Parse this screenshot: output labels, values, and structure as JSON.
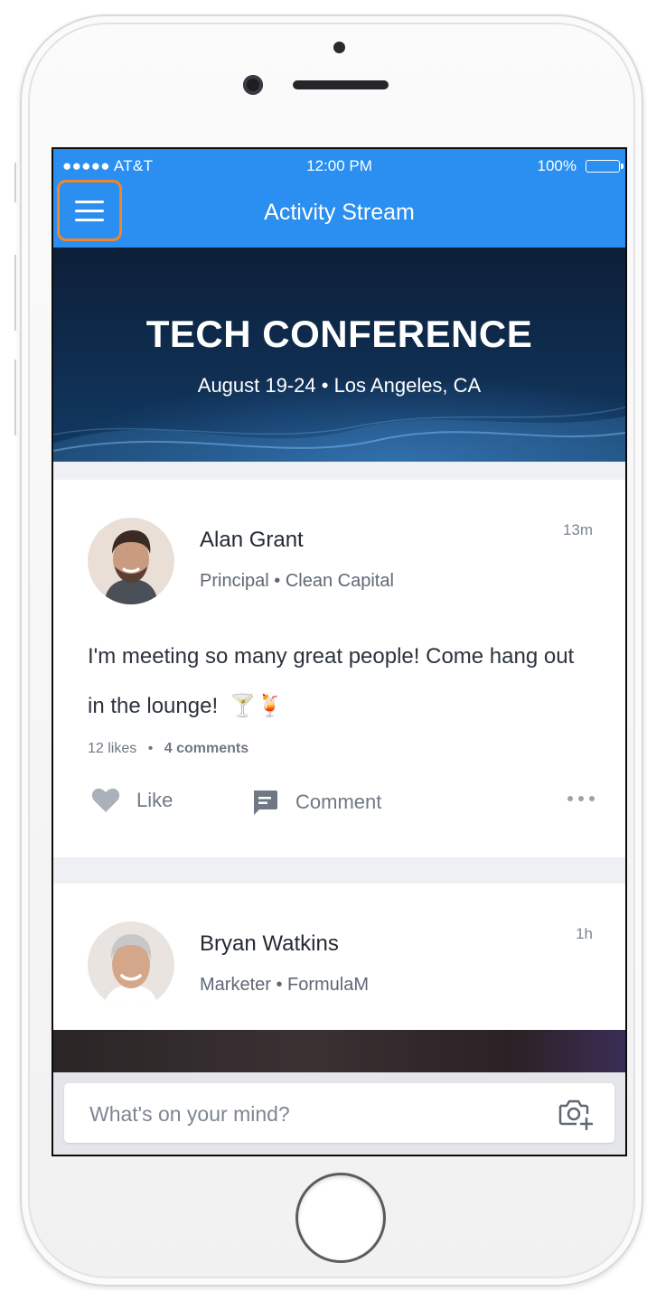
{
  "status_bar": {
    "carrier": "●●●●● AT&T",
    "time": "12:00 PM",
    "battery": "100%"
  },
  "header": {
    "menu_icon": "hamburger-menu-icon",
    "title": "Activity Stream"
  },
  "banner": {
    "title": "TECH CONFERENCE",
    "subtitle": "August 19-24  •  Los Angeles, CA"
  },
  "posts": [
    {
      "author": "Alan Grant",
      "role": "Principal",
      "company": "Clean Capital",
      "meta": "Principal  •  Clean Capital",
      "time": "13m",
      "text": "I'm meeting so many great people! Come hang out in the lounge!",
      "emoji": "🍸🍹",
      "likes": "12 likes",
      "comments": "4 comments",
      "actions": {
        "like": "Like",
        "comment": "Comment"
      }
    },
    {
      "author": "Bryan Watkins",
      "role": "Marketer",
      "company": "FormulaM",
      "meta": "Marketer  •  FormulaM",
      "time": "1h"
    }
  ],
  "composer": {
    "placeholder": "What's on your mind?",
    "icon": "camera-add-icon"
  },
  "colors": {
    "header_blue": "#2a8ff0",
    "highlight_orange": "#f2842c",
    "banner_navy": "#0f2d50",
    "text_gray": "#6f7884"
  }
}
